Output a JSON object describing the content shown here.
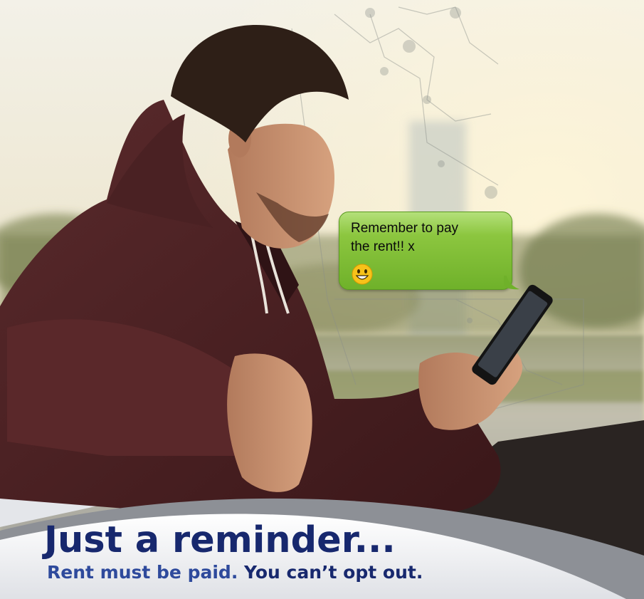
{
  "message": {
    "line1": "Remember to pay",
    "line2": "the rent!! x",
    "emoji": "grinning-face-emoji",
    "bubble_color": "#8cc63f"
  },
  "banner": {
    "title": "Just a reminder...",
    "subtitle_part1": "Rent must be paid.",
    "subtitle_part2": "You can’t opt out.",
    "title_color": "#17286e",
    "subtitle_color": "#2e4a9c"
  }
}
